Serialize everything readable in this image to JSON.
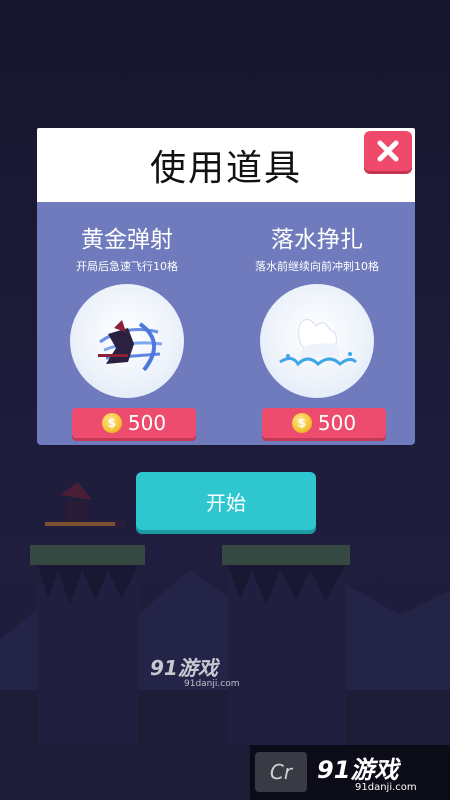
{
  "dialog": {
    "title": "使用道具",
    "close_icon": "close-icon"
  },
  "items": [
    {
      "name": "黄金弹射",
      "description": "开局后急速飞行10格",
      "price": "500",
      "art_icon": "flying-character-icon"
    },
    {
      "name": "落水挣扎",
      "description": "落水前继续向前冲刺10格",
      "price": "500",
      "art_icon": "water-splash-icon"
    }
  ],
  "start_button": {
    "label": "开始"
  },
  "watermarks": {
    "center_brand": "91游戏",
    "center_url": "91danji.com",
    "corner_brand": "91游戏",
    "corner_url": "91danji.com",
    "corner_badge": "Cr"
  },
  "colors": {
    "modal_body": "#6f7bbd",
    "close_button": "#ef4a6c",
    "price_button": "#ee4c6e",
    "start_button": "#2ec7cf"
  }
}
